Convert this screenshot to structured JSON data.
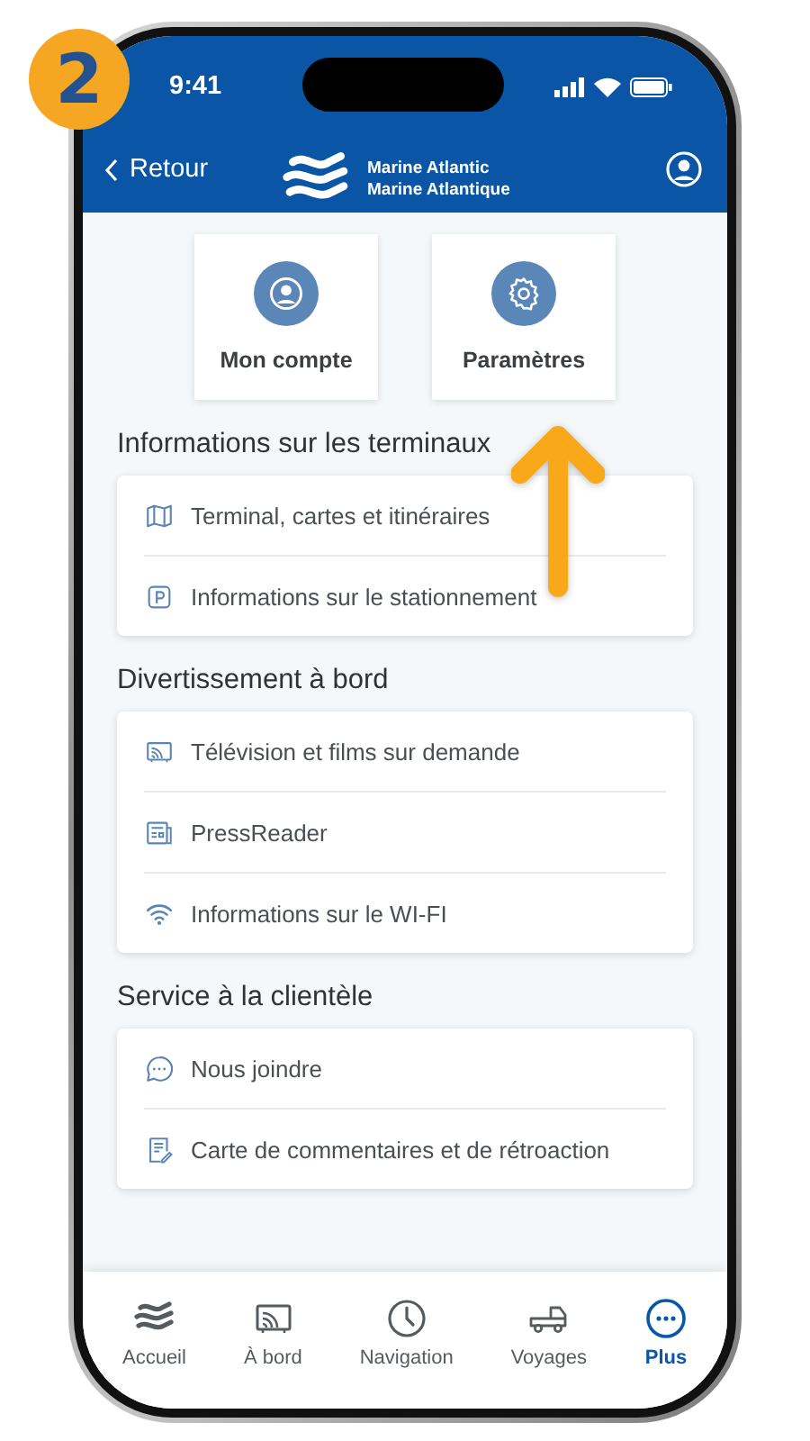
{
  "step_badge": "2",
  "status_bar": {
    "time": "9:41"
  },
  "header": {
    "back": "Retour",
    "logo_lines": [
      "Marine Atlantic",
      "Marine Atlantique"
    ]
  },
  "quick_tiles": [
    {
      "label": "Mon compte",
      "kind": "user"
    },
    {
      "label": "Paramètres",
      "kind": "gear"
    }
  ],
  "sections": [
    {
      "title": "Informations sur les terminaux",
      "items": [
        {
          "label": "Terminal, cartes et itinéraires",
          "kind": "map"
        },
        {
          "label": "Informations sur le stationnement",
          "kind": "parking"
        }
      ]
    },
    {
      "title": "Divertissement à bord",
      "items": [
        {
          "label": "Télévision et films sur demande",
          "kind": "tv"
        },
        {
          "label": "PressReader",
          "kind": "news"
        },
        {
          "label": "Informations sur le WI-FI",
          "kind": "wifi"
        }
      ]
    },
    {
      "title": "Service à la clientèle",
      "items": [
        {
          "label": "Nous joindre",
          "kind": "chat"
        },
        {
          "label": "Carte de commentaires et de rétroaction",
          "kind": "feedback"
        }
      ]
    }
  ],
  "tab_bar": [
    {
      "label": "Accueil",
      "kind": "waves",
      "selected": false
    },
    {
      "label": "À bord",
      "kind": "tv",
      "selected": false
    },
    {
      "label": "Navigation",
      "kind": "clock",
      "selected": false
    },
    {
      "label": "Voyages",
      "kind": "truck",
      "selected": false
    },
    {
      "label": "Plus",
      "kind": "more",
      "selected": true
    }
  ]
}
